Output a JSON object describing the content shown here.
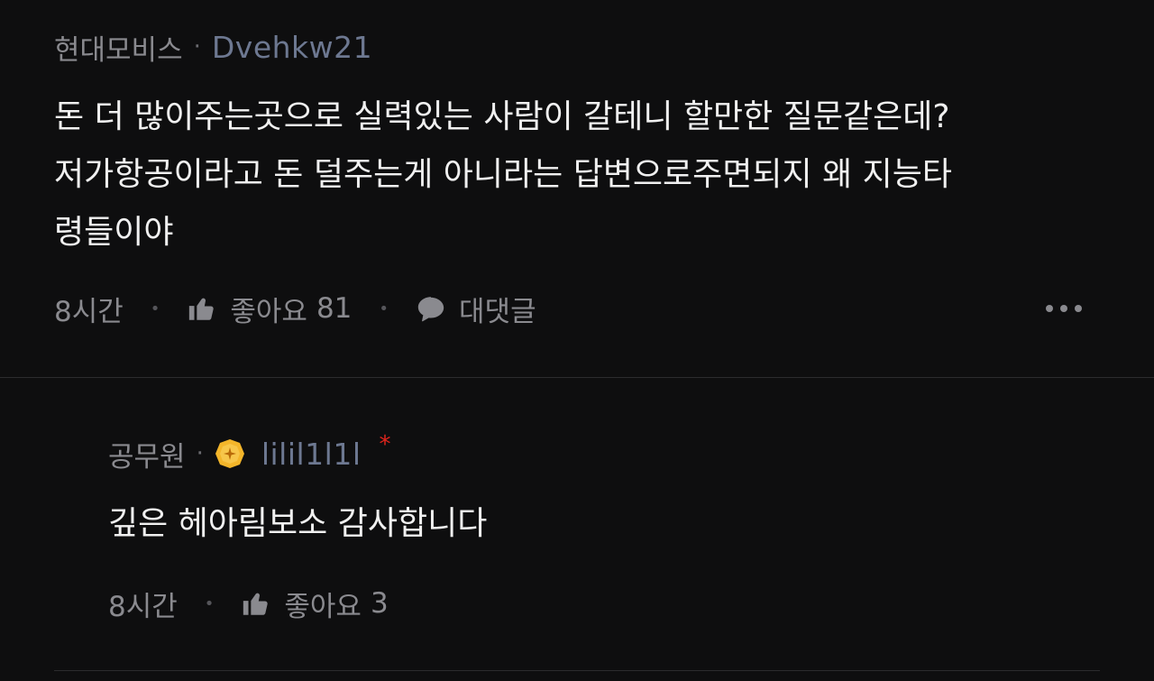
{
  "comments": [
    {
      "affiliation": "현대모비스",
      "separator": "·",
      "nickname": "Dvehkw21",
      "text": "돈 더 많이주는곳으로 실력있는 사람이 갈테니 할만한 질문같은데?\n저가항공이라고 돈 덜주는게 아니라는 답변으로주면되지 왜 지능타\n령들이야",
      "time": "8시간",
      "like_label": "좋아요",
      "like_count": "81",
      "reply_label": "대댓글",
      "more_icon": "more-dots-icon"
    },
    {
      "affiliation": "공무원",
      "separator": "·",
      "badge_icon": "gold-badge-icon",
      "nickname": "lilil1l1l",
      "star_mark": "*",
      "text": "깊은 헤아림보소 감사합니다",
      "time": "8시간",
      "like_label": "좋아요",
      "like_count": "3"
    }
  ],
  "colors": {
    "background": "#0e0e0f",
    "text": "#f0f0f0",
    "muted": "#8a8a8f",
    "nickname": "#6d7891",
    "badge": "#f3b52a",
    "star": "#e0241c"
  }
}
